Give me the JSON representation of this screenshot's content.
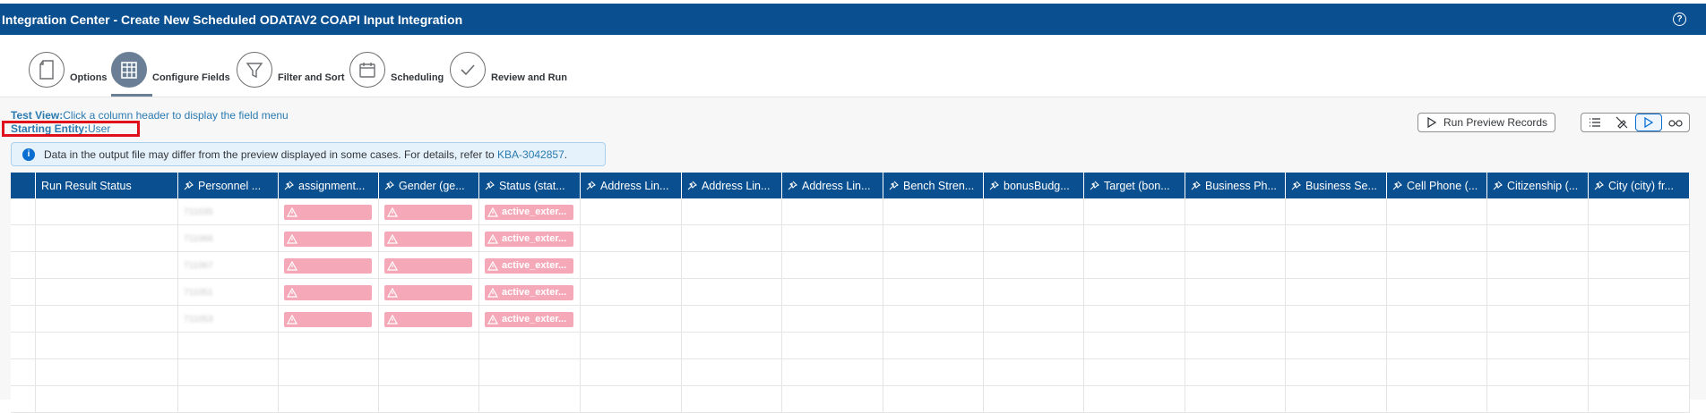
{
  "header": {
    "title": "Integration Center - Create New Scheduled ODATAV2 COAPI Input Integration",
    "help_glyph": "?"
  },
  "steps": [
    {
      "label": "Options",
      "icon": "document-icon"
    },
    {
      "label": "Configure Fields",
      "icon": "grid-icon",
      "active": true
    },
    {
      "label": "Filter and Sort",
      "icon": "funnel-icon"
    },
    {
      "label": "Scheduling",
      "icon": "calendar-icon"
    },
    {
      "label": "Review and Run",
      "icon": "checkmark-icon"
    }
  ],
  "testview": {
    "label": "Test View:",
    "text": "Click a column header to display the field menu"
  },
  "starting_entity": {
    "label": "Starting Entity:",
    "value": "User"
  },
  "info": {
    "text": "Data in the output file may differ from the preview displayed in some cases. For details, refer to ",
    "link": "KBA-3042857",
    "end": "."
  },
  "toolbar": {
    "run_preview_label": "Run Preview Records",
    "icons": [
      "list-icon",
      "edit-hide-icon",
      "play-icon",
      "glasses-icon"
    ]
  },
  "colors": {
    "header_blue": "#0a4f8f",
    "error_pink": "#f5a9b8",
    "link_blue": "#2a7ab0"
  },
  "table": {
    "columns": [
      {
        "label": "",
        "pin": false
      },
      {
        "label": "Run Result Status",
        "pin": false
      },
      {
        "label": "Personnel ...",
        "pin": true
      },
      {
        "label": "assignment...",
        "pin": true
      },
      {
        "label": "Gender (ge...",
        "pin": true
      },
      {
        "label": "Status (stat...",
        "pin": true
      },
      {
        "label": "Address Lin...",
        "pin": true
      },
      {
        "label": "Address Lin...",
        "pin": true
      },
      {
        "label": "Address Lin...",
        "pin": true
      },
      {
        "label": "Bench Stren...",
        "pin": true
      },
      {
        "label": "bonusBudg...",
        "pin": true
      },
      {
        "label": "Target (bon...",
        "pin": true
      },
      {
        "label": "Business Ph...",
        "pin": true
      },
      {
        "label": "Business Se...",
        "pin": true
      },
      {
        "label": "Cell Phone (...",
        "pin": true
      },
      {
        "label": "Citizenship (...",
        "pin": true
      },
      {
        "label": "City (city) fr...",
        "pin": true
      }
    ],
    "rows": [
      {
        "personnel": "711035",
        "status": "active_exter..."
      },
      {
        "personnel": "711066",
        "status": "active_exter..."
      },
      {
        "personnel": "711067",
        "status": "active_exter..."
      },
      {
        "personnel": "711051",
        "status": "active_exter..."
      },
      {
        "personnel": "711053",
        "status": "active_exter..."
      },
      {
        "personnel": "",
        "status": ""
      },
      {
        "personnel": "",
        "status": ""
      },
      {
        "personnel": "",
        "status": ""
      }
    ]
  }
}
